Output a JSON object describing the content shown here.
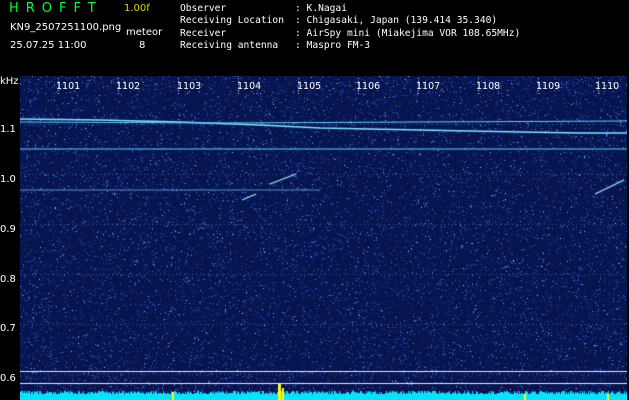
{
  "header": {
    "app_title": "HROFFT",
    "version": "1.00f",
    "filename": "KN9_2507251100.png",
    "mode": "meteor",
    "timestamp": "25.07.25 11:00",
    "count": "8"
  },
  "info": [
    {
      "label": "Observer",
      "value": ": K.Nagai"
    },
    {
      "label": "Receiving Location",
      "value": ": Chigasaki, Japan (139.414 35.340)"
    },
    {
      "label": "Receiver",
      "value": ": AirSpy mini (Miakejima VOR 108.65MHz)"
    },
    {
      "label": "Receiving antenna",
      "value": ": Maspro FM-3"
    }
  ],
  "plot": {
    "unit_label": "kHz",
    "y_ticks": [
      "1.1",
      "1.0",
      "0.9",
      "0.8",
      "0.7",
      "0.6"
    ],
    "x_ticks": [
      "1101",
      "1102",
      "1103",
      "1104",
      "1105",
      "1106",
      "1107",
      "1108",
      "1109",
      "1110"
    ],
    "colors": {
      "background": "#07154f",
      "trace": "#7fe8ff",
      "noise": "#5a8cff",
      "baseline": "#00e5ff",
      "marker": "#ffff00"
    }
  }
}
